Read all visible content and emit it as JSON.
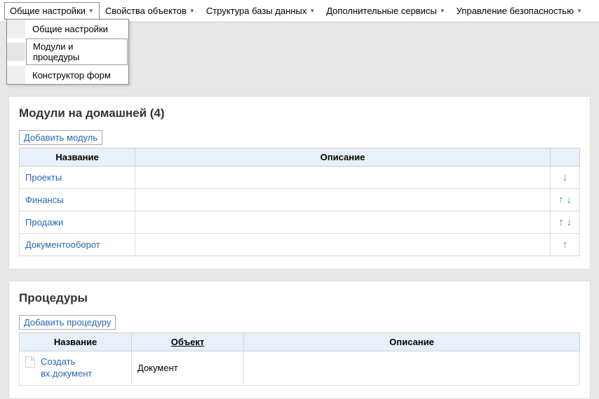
{
  "menubar": {
    "items": [
      "Общие настройки",
      "Свойства объектов",
      "Структура базы данных",
      "Дополнительные сервисы",
      "Управление безопасностью"
    ]
  },
  "dropdown": {
    "items": [
      "Общие настройки",
      "Модули и процедуры",
      "Конструктор форм"
    ],
    "hovered_index": 1
  },
  "modules_panel": {
    "title": "Модули на домашней (4)",
    "add_label": "Добавить модуль",
    "headers": {
      "name": "Название",
      "desc": "Описание"
    },
    "rows": [
      {
        "name": "Проекты",
        "desc": "",
        "up": false,
        "down": true
      },
      {
        "name": "Финансы",
        "desc": "",
        "up": true,
        "down": true
      },
      {
        "name": "Продажи",
        "desc": "",
        "up": true,
        "down": true
      },
      {
        "name": "Документооборот",
        "desc": "",
        "up": true,
        "down": false
      }
    ]
  },
  "procedures_panel": {
    "title": "Процедуры",
    "add_label": "Добавить процедуру",
    "headers": {
      "name": "Название",
      "object": "Объект",
      "desc": "Описание"
    },
    "rows": [
      {
        "name": "Создать вх.документ",
        "object": "Документ",
        "desc": ""
      }
    ]
  }
}
